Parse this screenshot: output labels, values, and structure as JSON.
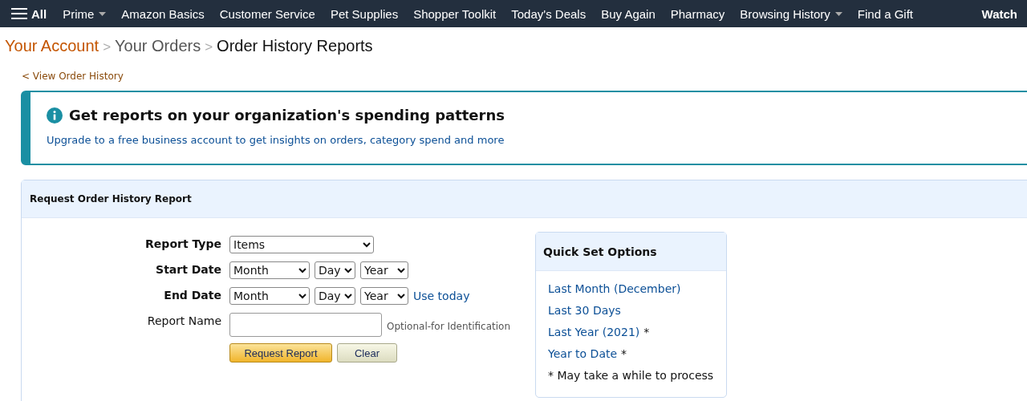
{
  "nav": {
    "menu_label": "All",
    "items": [
      {
        "label": "Prime",
        "dropdown": true
      },
      {
        "label": "Amazon Basics",
        "dropdown": false
      },
      {
        "label": "Customer Service",
        "dropdown": false
      },
      {
        "label": "Pet Supplies",
        "dropdown": false
      },
      {
        "label": "Shopper Toolkit",
        "dropdown": false
      },
      {
        "label": "Today's Deals",
        "dropdown": false
      },
      {
        "label": "Buy Again",
        "dropdown": false
      },
      {
        "label": "Pharmacy",
        "dropdown": false
      },
      {
        "label": "Browsing History",
        "dropdown": true
      },
      {
        "label": "Find a Gift",
        "dropdown": false
      }
    ],
    "promo": "Watch"
  },
  "breadcrumb": [
    {
      "label": "Your Account",
      "kind": "link"
    },
    {
      "label": "Your Orders",
      "kind": "link"
    },
    {
      "label": "Order History Reports",
      "kind": "current"
    }
  ],
  "breadcrumb_separator": ">",
  "back_link": "< View Order History",
  "info_banner": {
    "title": "Get reports on your organization's spending patterns",
    "link": "Upgrade to a free business account to get insights on orders, category spend and more"
  },
  "report_panel": {
    "title": "Request Order History Report",
    "fields": [
      {
        "label": "Report Type",
        "kind": "select",
        "values": [
          "Items"
        ]
      },
      {
        "label": "Start Date",
        "kind": "date",
        "values": [
          "Month",
          "Day",
          "Year"
        ]
      },
      {
        "label": "End Date",
        "kind": "date",
        "values": [
          "Month",
          "Day",
          "Year"
        ],
        "link": "Use today"
      },
      {
        "label": "Report Name",
        "kind": "text",
        "hint": "Optional-for Identification"
      }
    ],
    "buttons": [
      {
        "label": "Request Report",
        "kind": "primary"
      },
      {
        "label": "Clear",
        "kind": "secondary"
      }
    ],
    "quick_set": {
      "title": "Quick Set Options",
      "options": [
        {
          "label": "Last Month (December)"
        },
        {
          "label": "Last 30 Days"
        },
        {
          "label": "Last Year (2021)",
          "note": "*"
        },
        {
          "label": "Year to Date",
          "note": "*"
        }
      ],
      "footnote": "* May take a while to process"
    }
  }
}
